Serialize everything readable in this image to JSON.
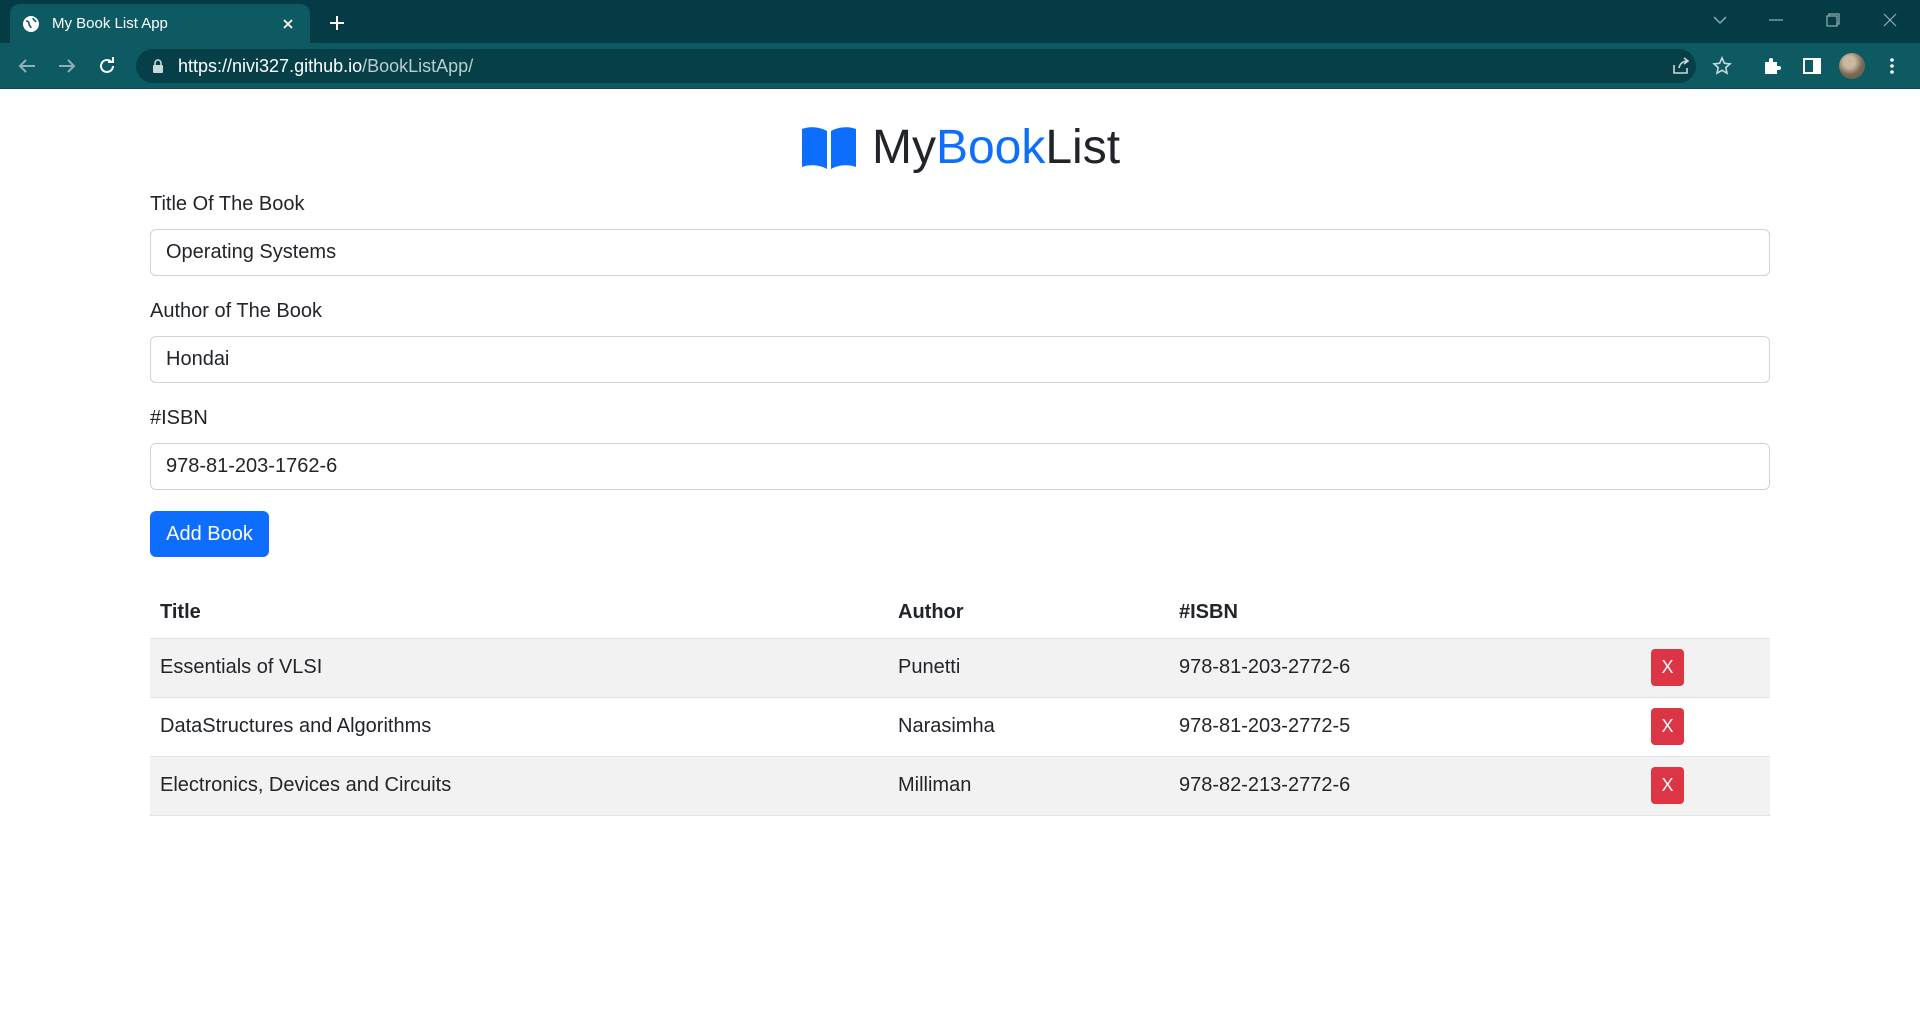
{
  "browser": {
    "tab_title": "My Book List App",
    "url_host": "https://nivi327.github.io",
    "url_path": "/BookListApp/"
  },
  "app": {
    "brand_prefix": "My",
    "brand_accent": "Book",
    "brand_suffix": "List",
    "accent_color": "#0d6efd",
    "danger_color": "#dc3545"
  },
  "form": {
    "title_label": "Title Of The Book",
    "title_value": "Operating Systems",
    "author_label": "Author of The Book",
    "author_value": "Hondai",
    "isbn_label": "#ISBN",
    "isbn_value": "978-81-203-1762-6",
    "submit_label": "Add Book"
  },
  "table": {
    "headers": [
      "Title",
      "Author",
      "#ISBN"
    ],
    "rows": [
      {
        "title": "Essentials of VLSI",
        "author": "Punetti",
        "isbn": "978-81-203-2772-6",
        "delete_label": "X"
      },
      {
        "title": "DataStructures and Algorithms",
        "author": "Narasimha",
        "isbn": "978-81-203-2772-5",
        "delete_label": "X"
      },
      {
        "title": "Electronics, Devices and Circuits",
        "author": "Milliman",
        "isbn": "978-82-213-2772-6",
        "delete_label": "X"
      }
    ]
  }
}
